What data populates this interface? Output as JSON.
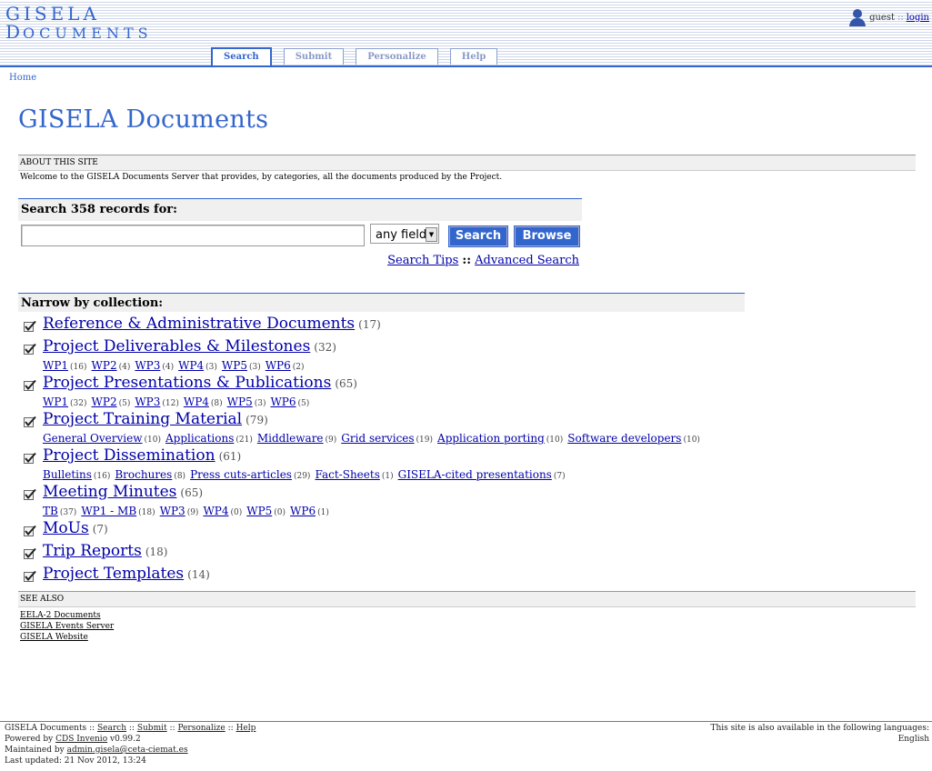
{
  "logo": {
    "line1": "GISELA",
    "line2_cap": "D",
    "line2_rest": "OCUMENTS"
  },
  "user": {
    "name": "guest",
    "separator": "::",
    "login": "login"
  },
  "tabs": [
    "Search",
    "Submit",
    "Personalize",
    "Help"
  ],
  "breadcrumb": "Home",
  "page_title": "GISELA Documents",
  "about": {
    "heading": "ABOUT THIS SITE",
    "text": "Welcome to the GISELA Documents Server that provides, by categories, all the documents produced by the Project."
  },
  "search": {
    "heading": "Search 358 records for:",
    "input_value": "",
    "field_selected": "any field",
    "search_button": "Search",
    "browse_button": "Browse",
    "tips_link": "Search Tips",
    "sep": "::",
    "advanced_link": "Advanced Search"
  },
  "narrow": {
    "heading": "Narrow by collection:",
    "collections": [
      {
        "name": "Reference & Administrative Documents",
        "count": "(17)",
        "subs": []
      },
      {
        "name": "Project Deliverables & Milestones",
        "count": "(32)",
        "subs": [
          {
            "name": "WP1",
            "count": "(16)"
          },
          {
            "name": "WP2",
            "count": "(4)"
          },
          {
            "name": "WP3",
            "count": "(4)"
          },
          {
            "name": "WP4",
            "count": "(3)"
          },
          {
            "name": "WP5",
            "count": "(3)"
          },
          {
            "name": "WP6",
            "count": "(2)"
          }
        ]
      },
      {
        "name": "Project Presentations & Publications",
        "count": "(65)",
        "subs": [
          {
            "name": "WP1",
            "count": "(32)"
          },
          {
            "name": "WP2",
            "count": "(5)"
          },
          {
            "name": "WP3",
            "count": "(12)"
          },
          {
            "name": "WP4",
            "count": "(8)"
          },
          {
            "name": "WP5",
            "count": "(3)"
          },
          {
            "name": "WP6",
            "count": "(5)"
          }
        ]
      },
      {
        "name": "Project Training Material",
        "count": "(79)",
        "subs": [
          {
            "name": "General Overview",
            "count": "(10)"
          },
          {
            "name": "Applications",
            "count": "(21)"
          },
          {
            "name": "Middleware",
            "count": "(9)"
          },
          {
            "name": "Grid services",
            "count": "(19)"
          },
          {
            "name": "Application porting",
            "count": "(10)"
          },
          {
            "name": "Software developers",
            "count": "(10)"
          }
        ]
      },
      {
        "name": "Project Dissemination",
        "count": "(61)",
        "subs": [
          {
            "name": "Bulletins",
            "count": "(16)"
          },
          {
            "name": "Brochures",
            "count": "(8)"
          },
          {
            "name": "Press cuts-articles",
            "count": "(29)"
          },
          {
            "name": "Fact-Sheets",
            "count": "(1)"
          },
          {
            "name": "GISELA-cited presentations",
            "count": "(7)"
          }
        ]
      },
      {
        "name": "Meeting Minutes",
        "count": "(65)",
        "subs": [
          {
            "name": "TB",
            "count": "(37)"
          },
          {
            "name": "WP1 - MB",
            "count": "(18)"
          },
          {
            "name": "WP3",
            "count": "(9)"
          },
          {
            "name": "WP4",
            "count": "(0)"
          },
          {
            "name": "WP5",
            "count": "(0)"
          },
          {
            "name": "WP6",
            "count": "(1)"
          }
        ]
      },
      {
        "name": "MoUs",
        "count": "(7)",
        "subs": []
      },
      {
        "name": "Trip Reports",
        "count": "(18)",
        "subs": []
      },
      {
        "name": "Project Templates",
        "count": "(14)",
        "subs": []
      }
    ]
  },
  "see_also": {
    "heading": "SEE ALSO",
    "links": [
      "EELA-2 Documents",
      "GISELA Events Server",
      "GISELA Website"
    ]
  },
  "footer": {
    "site": "GISELA Documents",
    "sep": "::",
    "links": [
      "Search",
      "Submit",
      "Personalize",
      "Help"
    ],
    "powered_prefix": "Powered by",
    "powered_link": "CDS Invenio",
    "powered_version": "v0.99.2",
    "maintained_prefix": "Maintained by",
    "maintained_link": "admin.gisela@ceta-ciemat.es",
    "updated": "Last updated: 21 Nov 2012, 13:24",
    "languages_note": "This site is also available in the following languages:",
    "language": "English"
  },
  "colors": {
    "accent": "#3366cc",
    "link": "#0000aa",
    "header_band": "#cdd6ea"
  }
}
